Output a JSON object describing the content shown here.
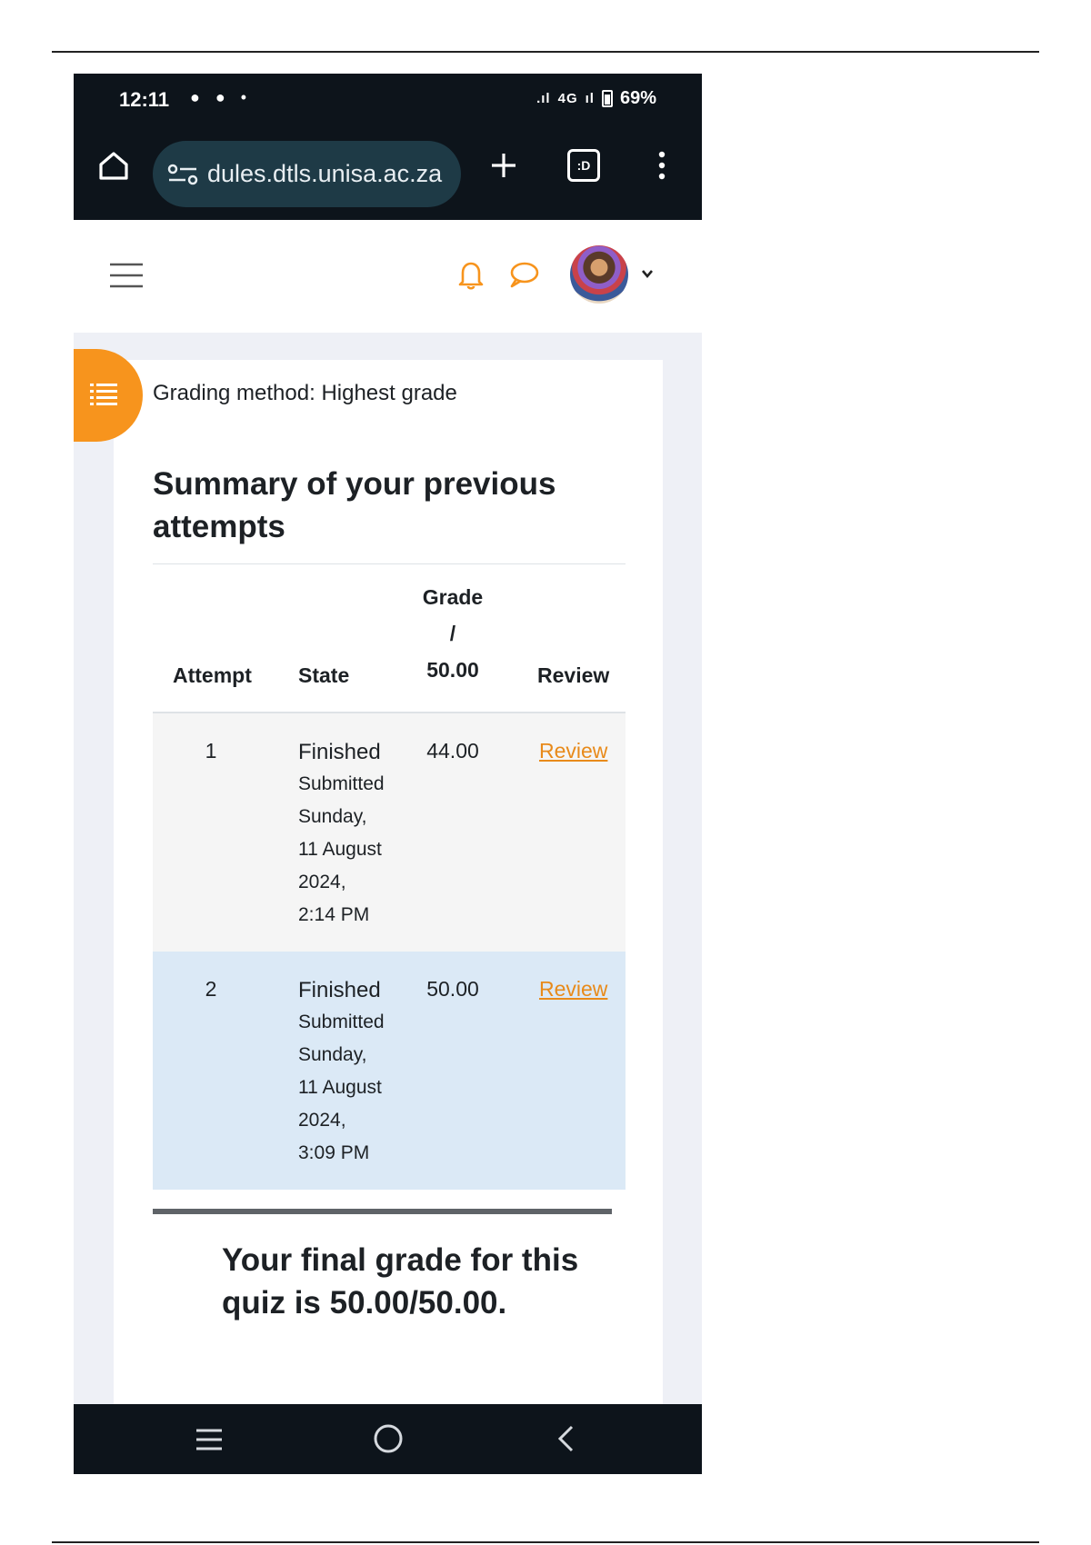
{
  "status_bar": {
    "time": "12:11",
    "notifications": "● ● •",
    "network": "4G",
    "battery": "69%"
  },
  "browser": {
    "url": "dules.dtls.unisa.ac.za",
    "tab_count": ":D"
  },
  "quiz": {
    "grading_method": "Grading method: Highest grade",
    "summary_heading": "Summary of your previous attempts",
    "columns": {
      "attempt": "Attempt",
      "state": "State",
      "grade_line1": "Grade",
      "grade_line2": "/",
      "grade_line3": "50.00",
      "review": "Review"
    },
    "attempts": [
      {
        "number": "1",
        "state": "Finished",
        "submitted": [
          "Submitted",
          "Sunday,",
          "11 August",
          "2024,",
          "2:14 PM"
        ],
        "grade": "44.00",
        "review": "Review"
      },
      {
        "number": "2",
        "state": "Finished",
        "submitted": [
          "Submitted",
          "Sunday,",
          "11 August",
          "2024,",
          "3:09 PM"
        ],
        "grade": "50.00",
        "review": "Review"
      }
    ],
    "final_grade": "Your final grade for this quiz is 50.00/50.00."
  },
  "colors": {
    "accent": "#f7941d",
    "link": "#e88a1a",
    "highlight_row": "#dbe9f6",
    "chrome_dark": "#0d141b",
    "url_pill": "#1e3a46"
  }
}
